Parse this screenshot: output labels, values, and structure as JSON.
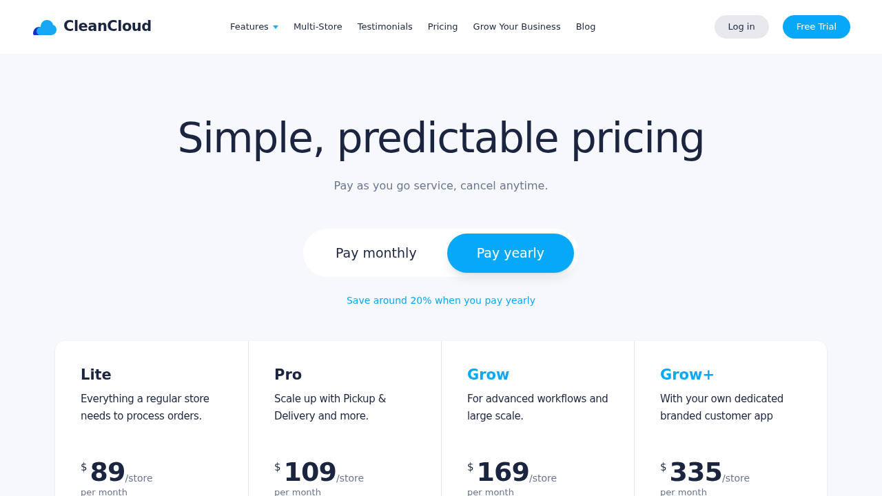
{
  "brand": {
    "name": "CleanCloud"
  },
  "nav": [
    {
      "label": "Features",
      "has_menu": true
    },
    {
      "label": "Multi-Store",
      "has_menu": false
    },
    {
      "label": "Testimonials",
      "has_menu": false
    },
    {
      "label": "Pricing",
      "has_menu": false
    },
    {
      "label": "Grow Your Business",
      "has_menu": false
    },
    {
      "label": "Blog",
      "has_menu": false
    }
  ],
  "actions": {
    "login": "Log in",
    "trial": "Free Trial"
  },
  "hero": {
    "title": "Simple, predictable pricing",
    "subtitle": "Pay as you go service, cancel anytime."
  },
  "billing_toggle": [
    {
      "label": "Pay monthly",
      "selected": false
    },
    {
      "label": "Pay yearly",
      "selected": true
    }
  ],
  "savings_note": "Save around 20% when you pay yearly",
  "plans": [
    {
      "name": "Lite",
      "featured": false,
      "description": "Everything a regular store needs to process orders.",
      "currency": "$",
      "price": "89",
      "unit": "/store",
      "period": "per month"
    },
    {
      "name": "Pro",
      "featured": false,
      "description": "Scale up with Pickup & Delivery and more.",
      "currency": "$",
      "price": "109",
      "unit": "/store",
      "period": "per month"
    },
    {
      "name": "Grow",
      "featured": true,
      "description": "For advanced workflows and large scale.",
      "currency": "$",
      "price": "169",
      "unit": "/store",
      "period": "per month"
    },
    {
      "name": "Grow+",
      "featured": true,
      "description": "With your own dedicated branded customer app",
      "currency": "$",
      "price": "335",
      "unit": "/store",
      "period": "per month"
    }
  ]
}
